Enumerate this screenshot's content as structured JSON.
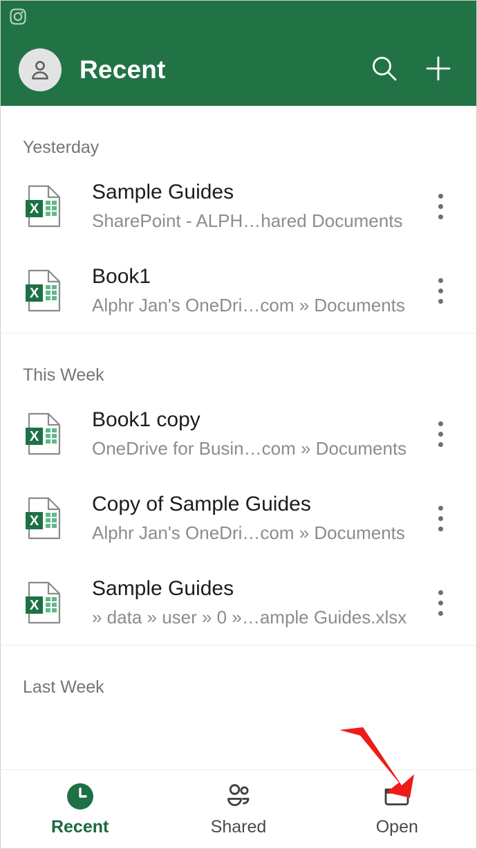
{
  "status_bar": {
    "icon": "camera-icon"
  },
  "header": {
    "title": "Recent",
    "avatar_icon": "person-avatar-icon",
    "search_icon": "search-icon",
    "add_icon": "plus-icon",
    "background_color": "#217346",
    "title_color": "#ffffff"
  },
  "sections": [
    {
      "label": "Yesterday",
      "items": [
        {
          "title": "Sample Guides",
          "subtitle": "SharePoint - ALPH…hared Documents",
          "file_icon": "excel-file-icon",
          "more_icon": "more-vertical-icon"
        },
        {
          "title": "Book1",
          "subtitle": "Alphr Jan's OneDri…com » Documents",
          "file_icon": "excel-file-icon",
          "more_icon": "more-vertical-icon"
        }
      ]
    },
    {
      "label": "This Week",
      "items": [
        {
          "title": "Book1 copy",
          "subtitle": "OneDrive for Busin…com » Documents",
          "file_icon": "excel-file-icon",
          "more_icon": "more-vertical-icon"
        },
        {
          "title": "Copy of Sample Guides",
          "subtitle": "Alphr Jan's OneDri…com » Documents",
          "file_icon": "excel-file-icon",
          "more_icon": "more-vertical-icon"
        },
        {
          "title": "Sample Guides",
          "subtitle": " » data » user » 0 »…ample Guides.xlsx",
          "file_icon": "excel-file-icon",
          "more_icon": "more-vertical-icon"
        }
      ]
    },
    {
      "label": "Last Week",
      "items": []
    }
  ],
  "bottom_nav": {
    "items": [
      {
        "label": "Recent",
        "icon": "clock-icon",
        "active": true
      },
      {
        "label": "Shared",
        "icon": "people-icon",
        "active": false
      },
      {
        "label": "Open",
        "icon": "folder-icon",
        "active": false
      }
    ],
    "active_color": "#1a6b3c",
    "inactive_color": "#4a4a4a"
  },
  "annotation": {
    "type": "arrow",
    "color": "#ee1c19",
    "points_to": "Open"
  }
}
